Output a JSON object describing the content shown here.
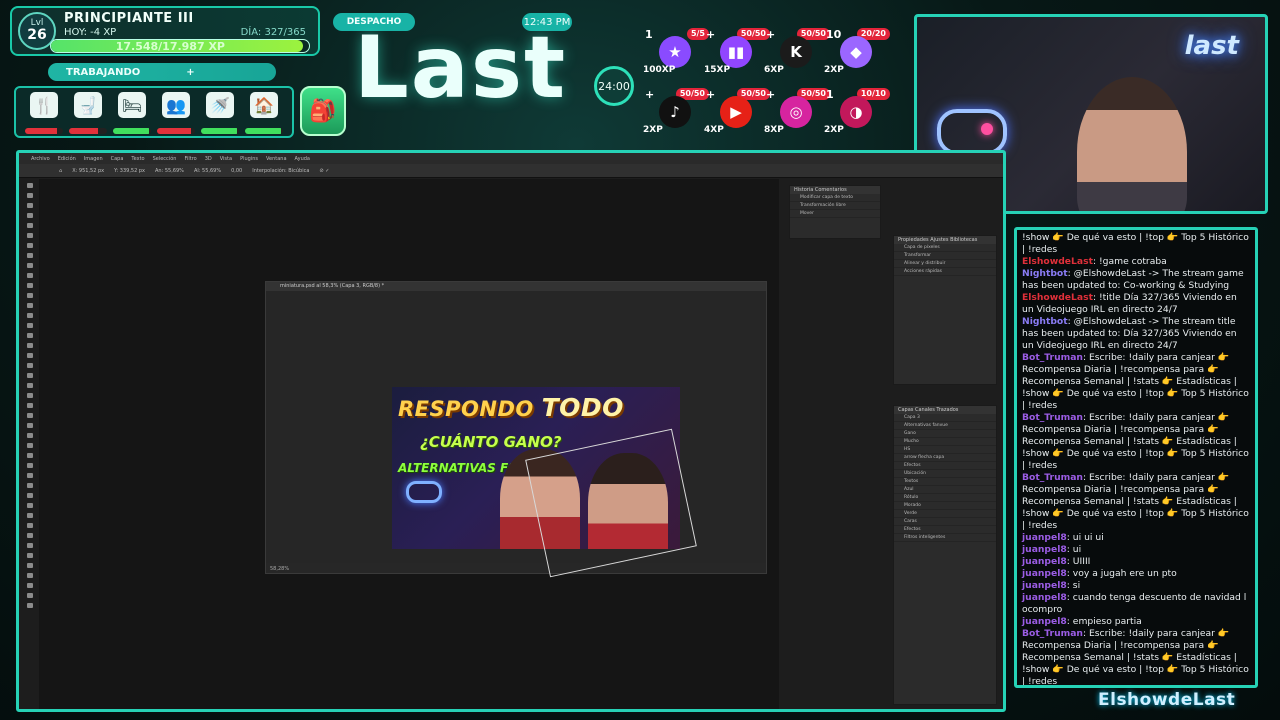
{
  "hud": {
    "level_label": "Lvl",
    "level_value": "26",
    "rank": "PRINCIPIANTE III",
    "today": "HOY: -4 XP",
    "day_counter": "DÍA: 327/365",
    "xp_text": "17.548/17.987 XP",
    "xp_progress": 0.975,
    "status_label": "TRABAJANDO",
    "status_plus": "+",
    "dispatch_label": "DESPACHO",
    "clock": "12:43 PM",
    "stream_logo": "Last",
    "timer": "24:00",
    "needs": [
      {
        "icon": "food-icon",
        "glyph": "🍴",
        "level": 0.85,
        "color": "#e1323b"
      },
      {
        "icon": "toilet-icon",
        "glyph": "🚽",
        "level": 0.75,
        "color": "#e1323b"
      },
      {
        "icon": "sleep-icon",
        "glyph": "🛏",
        "level": 0.95,
        "color": "#41e05e"
      },
      {
        "icon": "social-icon",
        "glyph": "👥",
        "level": 0.9,
        "color": "#e1323b"
      },
      {
        "icon": "shower-icon",
        "glyph": "🚿",
        "level": 0.95,
        "color": "#41e05e"
      },
      {
        "icon": "home-icon",
        "glyph": "🏠",
        "level": 0.95,
        "color": "#41e05e"
      }
    ],
    "goals": [
      {
        "name": "star-goal",
        "count": "5/5",
        "prefix": "1",
        "xp": "100XP",
        "color": "#8a4bff",
        "glyph": "★"
      },
      {
        "name": "twitch-goal",
        "count": "50/50",
        "prefix": "+",
        "xp": "15XP",
        "color": "#9146ff",
        "glyph": "▮▮"
      },
      {
        "name": "kick-goal",
        "count": "50/50",
        "prefix": "+",
        "xp": "6XP",
        "color": "#1b1b1b",
        "glyph": "K"
      },
      {
        "name": "crystal-goal",
        "count": "20/20",
        "prefix": "10",
        "xp": "2XP",
        "color": "#9b66ff",
        "glyph": "◆"
      },
      {
        "name": "tiktok-goal",
        "count": "50/50",
        "prefix": "+",
        "xp": "2XP",
        "color": "#111111",
        "glyph": "♪"
      },
      {
        "name": "youtube-goal",
        "count": "50/50",
        "prefix": "+",
        "xp": "4XP",
        "color": "#e62117",
        "glyph": "▶"
      },
      {
        "name": "instagram-goal",
        "count": "50/50",
        "prefix": "+",
        "xp": "8XP",
        "color": "#d6249f",
        "glyph": "◎"
      },
      {
        "name": "gauge-goal",
        "count": "10/10",
        "prefix": "1",
        "xp": "2XP",
        "color": "#c2185b",
        "glyph": "◑"
      }
    ]
  },
  "cam": {
    "logo": "last"
  },
  "chat": [
    {
      "user": "",
      "cls": "",
      "text": "!show 👉 De qué va esto | !top 👉 Top 5 Histórico | !redes"
    },
    {
      "user": "ElshowdeLast",
      "cls": "red",
      "text": ": !game cotraba"
    },
    {
      "user": "Nightbot",
      "cls": "nb",
      "text": ": @ElshowdeLast -> The stream game has been updated to: Co-working & Studying"
    },
    {
      "user": "ElshowdeLast",
      "cls": "red",
      "text": ": !title Día 327/365 Viviendo en un Videojuego IRL en directo 24/7"
    },
    {
      "user": "Nightbot",
      "cls": "nb",
      "text": ": @ElshowdeLast -> The stream title has been updated to: Día 327/365 Viviendo en un Videojuego IRL en directo 24/7"
    },
    {
      "user": "Bot_Truman",
      "cls": "purple",
      "text": ": Escribe: !daily para canjear 👉 Recompensa Diaria | !recompensa para 👉 Recompensa Semanal | !stats 👉 Estadísticas | !show 👉 De qué va esto | !top 👉 Top 5 Histórico | !redes"
    },
    {
      "user": "Bot_Truman",
      "cls": "purple",
      "text": ": Escribe: !daily para canjear 👉 Recompensa Diaria | !recompensa para 👉 Recompensa Semanal | !stats 👉 Estadísticas | !show 👉 De qué va esto | !top 👉 Top 5 Histórico | !redes"
    },
    {
      "user": "Bot_Truman",
      "cls": "purple",
      "text": ": Escribe: !daily para canjear 👉 Recompensa Diaria | !recompensa para 👉 Recompensa Semanal | !stats 👉 Estadísticas | !show 👉 De qué va esto | !top 👉 Top 5 Histórico | !redes"
    },
    {
      "user": "juanpel8",
      "cls": "purple",
      "text": ": ui ui ui"
    },
    {
      "user": "juanpel8",
      "cls": "purple",
      "text": ": ui"
    },
    {
      "user": "juanpel8",
      "cls": "purple",
      "text": ": UIIII"
    },
    {
      "user": "juanpel8",
      "cls": "purple",
      "text": ": voy a jugah ere un pto"
    },
    {
      "user": "juanpel8",
      "cls": "purple",
      "text": ": si"
    },
    {
      "user": "juanpel8",
      "cls": "purple",
      "text": ": cuando tenga descuento de navidad l ocompro"
    },
    {
      "user": "juanpel8",
      "cls": "purple",
      "text": ": empieso partia"
    },
    {
      "user": "Bot_Truman",
      "cls": "purple",
      "text": ": Escribe: !daily para canjear 👉 Recompensa Diaria | !recompensa para 👉 Recompensa Semanal | !stats 👉 Estadísticas | !show 👉 De qué va esto | !top 👉 Top 5 Histórico | !redes"
    }
  ],
  "watermark": "ElshowdeLast",
  "photoshop": {
    "menu": [
      "Archivo",
      "Edición",
      "Imagen",
      "Capa",
      "Texto",
      "Selección",
      "Filtro",
      "3D",
      "Vista",
      "Plugins",
      "Ventana",
      "Ayuda"
    ],
    "doc_title": "miniatura.psd al 58,3% (Capa 3, RGB/8) *",
    "zoom_status": "58,28%",
    "thumbnail": {
      "line1_a": "RESPONDO ",
      "line1_b": "TODO",
      "line2": "¿CUÁNTO GANO?",
      "line3": "ALTERNATIVAS FANVUE"
    },
    "history_tabs": "Historia   Comentarios",
    "history_rows": [
      "Modificar capa de texto",
      "Transformación libre",
      "Mover"
    ],
    "props_tabs": "Propiedades   Ajustes   Bibliotecas",
    "props_rows": [
      "Capa de píxeles",
      "Transformar",
      "Alinear y distribuir",
      "Acciones rápidas"
    ],
    "layers_tabs": "Capas   Canales   Trazados",
    "layer_rows": [
      "Capa 3",
      "Alternativas fanvue",
      "Gano",
      "Mucho",
      "HS",
      "arrow flecha capa",
      "Efectos",
      "Ubicación",
      "Textos",
      "Azul",
      "Rótulo",
      "Morado",
      "Verde",
      "Caras",
      "Efectos",
      "Filtros inteligentes"
    ]
  }
}
